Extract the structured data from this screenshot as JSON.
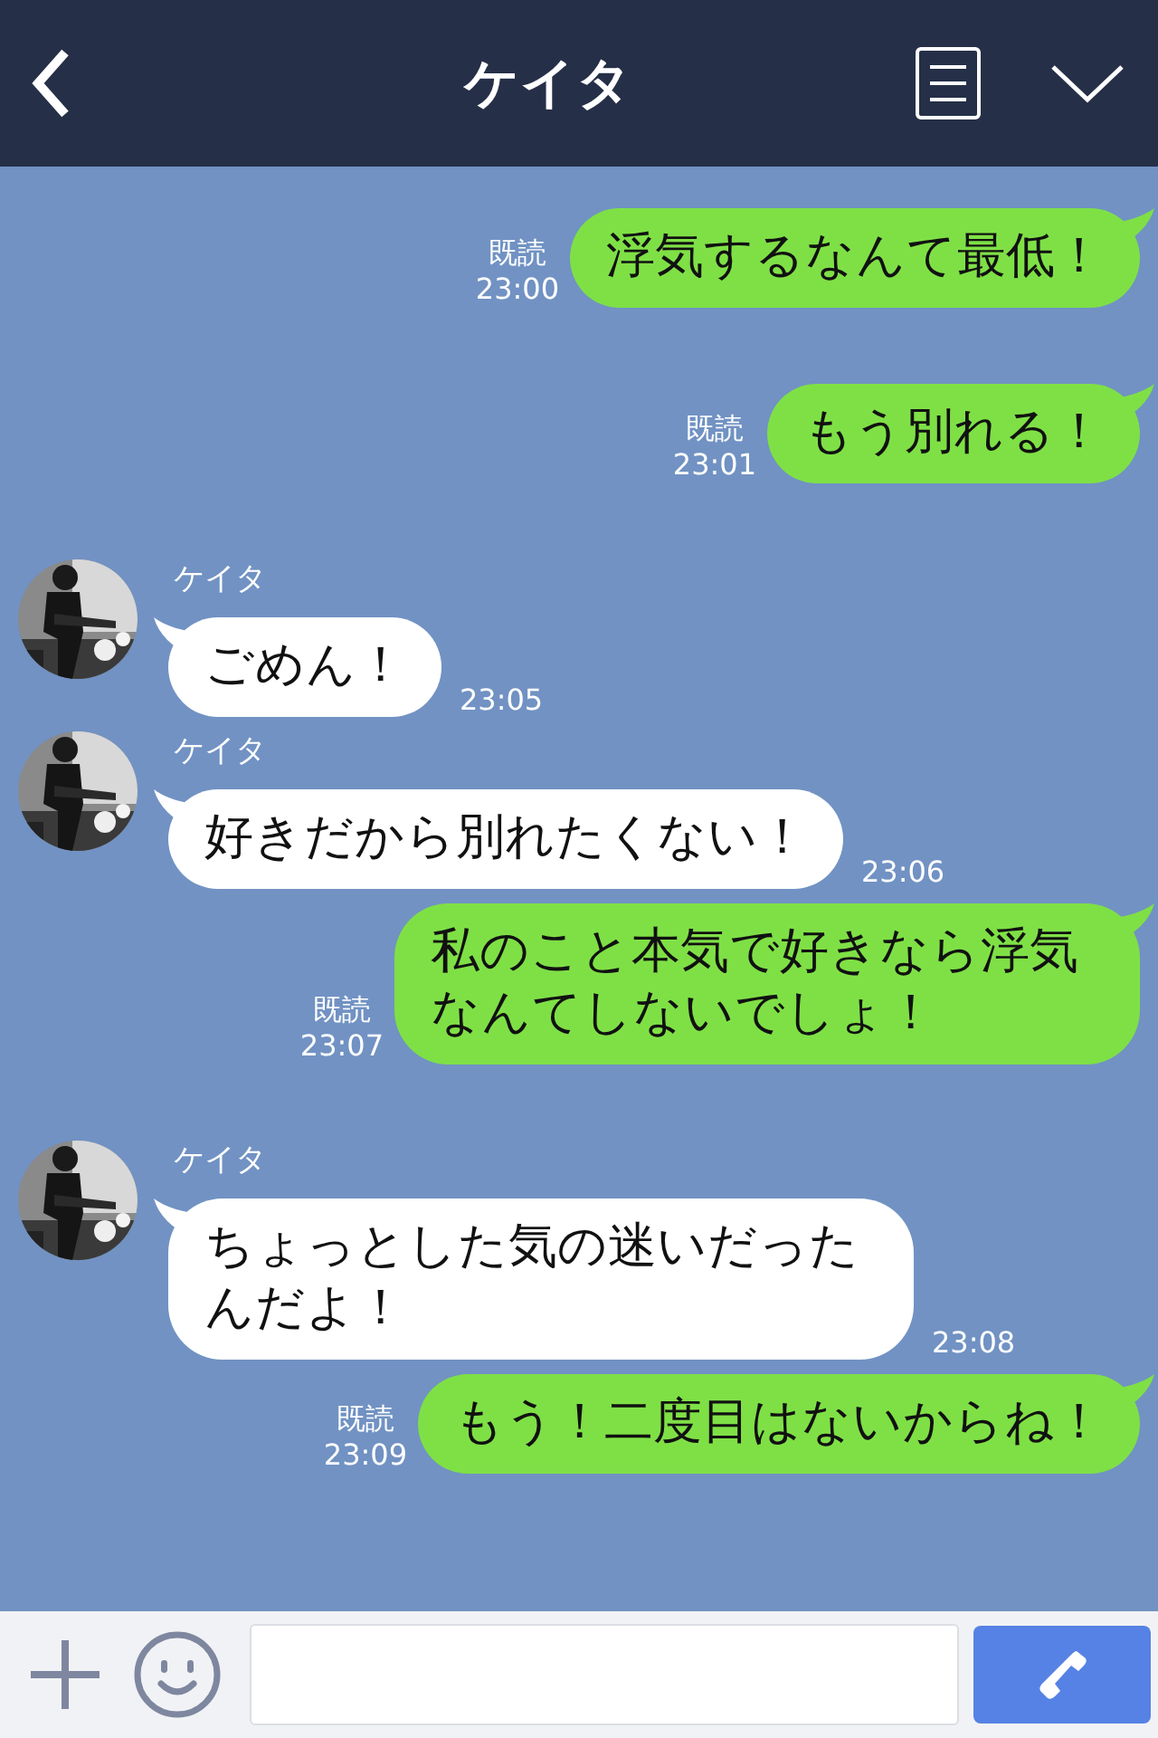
{
  "header": {
    "title": "ケイタ"
  },
  "messages": [
    {
      "kind": "sent",
      "read": "既読",
      "time": "23:00",
      "text": "浮気するなんて最低！"
    },
    {
      "kind": "sent",
      "read": "既読",
      "time": "23:01",
      "text": "もう別れる！"
    },
    {
      "kind": "received",
      "name": "ケイタ",
      "time": "23:05",
      "text": "ごめん！"
    },
    {
      "kind": "received",
      "name": "ケイタ",
      "time": "23:06",
      "text": "好きだから別れたくない！"
    },
    {
      "kind": "sent",
      "read": "既読",
      "time": "23:07",
      "text": "私のこと本気で好きなら浮気なんてしないでしょ！"
    },
    {
      "kind": "received",
      "name": "ケイタ",
      "time": "23:08",
      "text": "ちょっとした気の迷いだったんだよ！"
    },
    {
      "kind": "sent",
      "read": "既読",
      "time": "23:09",
      "text": "もう！二度目はないからね！"
    }
  ]
}
